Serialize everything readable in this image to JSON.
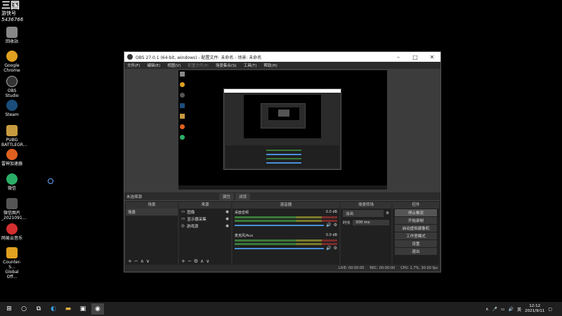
{
  "desktop": {
    "logo": {
      "title": "三国",
      "subtitle": "游侠号",
      "number": "5436766"
    },
    "icons": [
      {
        "label": "回收站",
        "color": "#888888"
      },
      {
        "label": "Google Chrome",
        "color": "#e0a020"
      },
      {
        "label": "OBS Studio",
        "color": "#333333"
      },
      {
        "label": "Steam",
        "color": "#1b4d7a"
      },
      {
        "label": "PUBG BATTLEGR...",
        "color": "#c89a40"
      },
      {
        "label": "雷神加速器",
        "color": "#e06020"
      },
      {
        "label": "微信",
        "color": "#2aae67"
      },
      {
        "label": "微信图片_2021091...",
        "color": "#555555"
      },
      {
        "label": "网易云音乐",
        "color": "#d32f2f"
      },
      {
        "label": "Counter-S... Global Off...",
        "color": "#e0a020"
      }
    ]
  },
  "obs": {
    "title": "OBS 27.0.1 (64-bit, windows) - 配置文件: 未命名 - 场景: 未命名",
    "menu": [
      "文件(F)",
      "编辑(E)",
      "视图(V)",
      "配置文件(P)",
      "场景集合(S)",
      "工具(T)",
      "帮助(H)"
    ],
    "scene_label": "未选择源",
    "scene_buttons": [
      "属性",
      "滤镜"
    ],
    "docks": {
      "scenes": {
        "header": "场景",
        "items": [
          "场景"
        ]
      },
      "sources": {
        "header": "来源",
        "items": [
          "图像",
          "显示器采集",
          "游戏源"
        ]
      },
      "mixer": {
        "header": "混音器",
        "channels": [
          {
            "name": "桌面音频",
            "level": "0.0 dB"
          },
          {
            "name": "麦克风/Aux",
            "level": "0.0 dB"
          }
        ]
      },
      "transitions": {
        "header": "场景转场",
        "type": "淡出",
        "duration_label": "时长",
        "duration": "300 ms"
      },
      "controls": {
        "header": "控件",
        "buttons": [
          "停止推流",
          "开始录制",
          "启动虚拟摄像机",
          "工作室模式",
          "设置",
          "退出"
        ]
      }
    },
    "status": {
      "live": "LIVE: 00:00:00",
      "rec": "REC: 00:00:00",
      "cpu": "CPU: 1.7%, 30.00 fps"
    }
  },
  "taskbar": {
    "start_icon": "windows-logo",
    "time": "12:12",
    "date": "2021/9/11",
    "lang": "英"
  }
}
